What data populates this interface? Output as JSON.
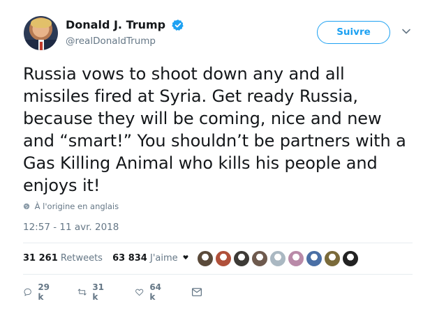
{
  "author": {
    "display_name": "Donald J. Trump",
    "handle": "@realDonaldTrump"
  },
  "follow_button": {
    "label": "Suivre"
  },
  "tweet": {
    "text": "Russia vows to shoot down any and all missiles fired at Syria. Get ready Russia, because they will be coming, nice and new and “smart!” You shouldn’t be partners with a Gas Killing Animal who kills his people and enjoys it!",
    "translation_note": "À l'origine en anglais",
    "timestamp": "12:57 - 11 avr. 2018"
  },
  "stats": {
    "retweets_count": "31 261",
    "retweets_label": "Retweets",
    "likes_count": "63 834",
    "likes_label": "J'aime"
  },
  "likers": [
    {
      "name": "liker-avatar-1",
      "color": "#5a4a3a"
    },
    {
      "name": "liker-avatar-2",
      "color": "#b0503a"
    },
    {
      "name": "liker-avatar-3",
      "color": "#3d3a36"
    },
    {
      "name": "liker-avatar-4",
      "color": "#6e5a4e"
    },
    {
      "name": "liker-avatar-5",
      "color": "#aab8c2"
    },
    {
      "name": "liker-avatar-6",
      "color": "#b98aa8"
    },
    {
      "name": "liker-avatar-7",
      "color": "#4a6fa5"
    },
    {
      "name": "liker-avatar-8",
      "color": "#7a6a3a"
    },
    {
      "name": "liker-avatar-9",
      "color": "#222222"
    }
  ],
  "actions": {
    "reply_count": "29 k",
    "retweet_count": "31 k",
    "like_count": "64 k"
  },
  "icons": {
    "verified": "verified-badge-icon",
    "caret": "chevron-down-icon",
    "globe": "globe-icon",
    "reply": "reply-icon",
    "retweet": "retweet-icon",
    "like": "heart-icon",
    "dm": "envelope-icon"
  },
  "colors": {
    "accent": "#1da1f2",
    "secondary_text": "#657786",
    "primary_text": "#14171a",
    "like_red": "#e0245e"
  }
}
